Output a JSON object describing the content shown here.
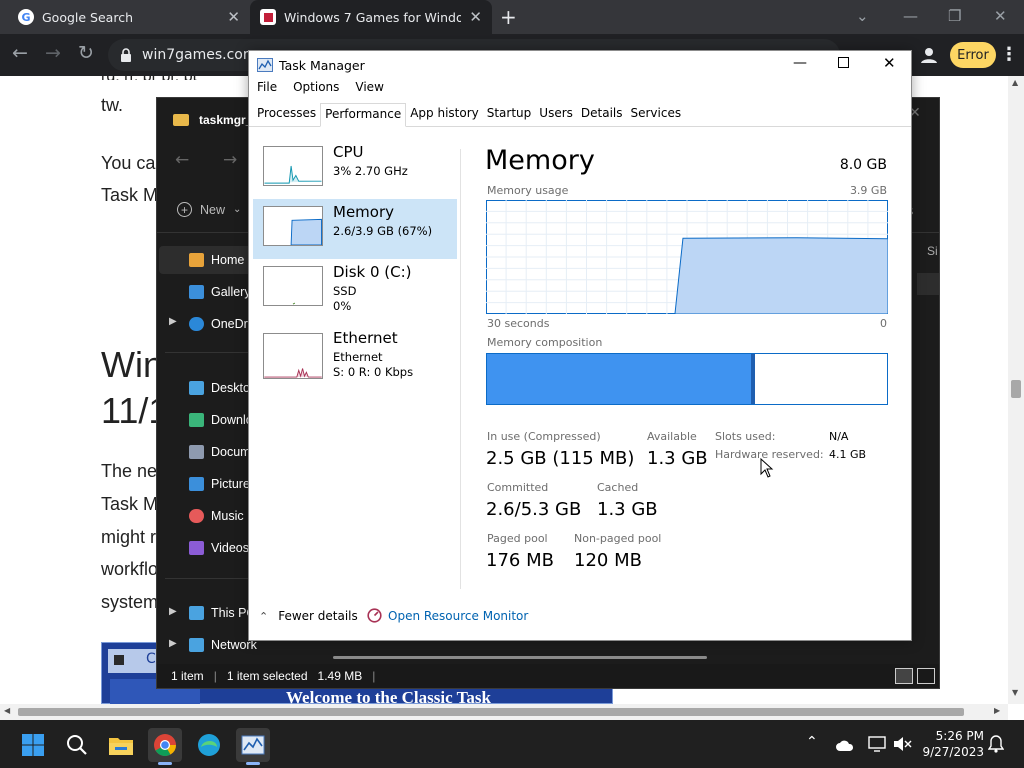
{
  "browser": {
    "tabs": [
      {
        "title": "Google Search",
        "active": false
      },
      {
        "title": "Windows 7 Games for Windows",
        "active": true
      }
    ],
    "new_tab_symbol": "+",
    "url": "win7games.com",
    "error_button": "Error"
  },
  "webpage": {
    "line1": "tw.",
    "para1_a": "You ca",
    "para1_b": "Task M",
    "heading_a": "Win",
    "heading_b": "11/1",
    "para2": [
      "The ne",
      "Task M",
      "might r",
      "workflo",
      "system"
    ],
    "banner_text": "Welcome to the Classic Task",
    "banner_label": "C"
  },
  "explorer": {
    "title": "taskmgr_",
    "new_label": "New",
    "sidebar": [
      {
        "label": "Home",
        "icon": "home-icon",
        "color": "#e8a33a"
      },
      {
        "label": "Gallery",
        "icon": "gallery-icon",
        "color": "#3b8fdb"
      },
      {
        "label": "OneDri",
        "icon": "onedrive-icon",
        "color": "#2b88d8"
      },
      {
        "label": "Deskto",
        "icon": "desktop-icon",
        "color": "#4aa3e0"
      },
      {
        "label": "Downlo",
        "icon": "download-icon",
        "color": "#3ab57a"
      },
      {
        "label": "Docum",
        "icon": "documents-icon",
        "color": "#8e9aaf"
      },
      {
        "label": "Picture",
        "icon": "pictures-icon",
        "color": "#3b8fdb"
      },
      {
        "label": "Music",
        "icon": "music-icon",
        "color": "#e65a5a"
      },
      {
        "label": "Videos",
        "icon": "videos-icon",
        "color": "#8b5cd6"
      },
      {
        "label": "This PC",
        "icon": "pc-icon",
        "color": "#4aa3e0"
      },
      {
        "label": "Network",
        "icon": "network-icon",
        "color": "#4aa3e0"
      }
    ],
    "col_header": "Si",
    "status": {
      "items": "1 item",
      "selected": "1 item selected",
      "size": "1.49 MB"
    }
  },
  "taskmanager": {
    "title": "Task Manager",
    "menu": [
      "File",
      "Options",
      "View"
    ],
    "tabs": [
      "Processes",
      "Performance",
      "App history",
      "Startup",
      "Users",
      "Details",
      "Services"
    ],
    "selected_tab": "Performance",
    "resources": [
      {
        "name": "CPU",
        "line1": "3%  2.70 GHz",
        "line2": "",
        "selected": false
      },
      {
        "name": "Memory",
        "line1": "2.6/3.9 GB (67%)",
        "line2": "",
        "selected": true
      },
      {
        "name": "Disk 0 (C:)",
        "line1": "SSD",
        "line2": "0%",
        "selected": false
      },
      {
        "name": "Ethernet",
        "line1": "Ethernet",
        "line2": "S: 0  R: 0 Kbps",
        "selected": false
      }
    ],
    "memory": {
      "title": "Memory",
      "total": "8.0 GB",
      "usage_label": "Memory usage",
      "usage_max": "3.9 GB",
      "graph_left": "30 seconds",
      "graph_right": "0",
      "usage_level": 0.66,
      "composition_label": "Memory composition",
      "composition_in_use": 0.66,
      "composition_modified": 0.01,
      "stats": {
        "in_use_label": "In use (Compressed)",
        "in_use": "2.5 GB (115 MB)",
        "available_label": "Available",
        "available": "1.3 GB",
        "committed_label": "Committed",
        "committed": "2.6/5.3 GB",
        "cached_label": "Cached",
        "cached": "1.3 GB",
        "paged_label": "Paged pool",
        "paged": "176 MB",
        "nonpaged_label": "Non-paged pool",
        "nonpaged": "120 MB",
        "slots_label": "Slots used:",
        "slots": "N/A",
        "hw_label": "Hardware reserved:",
        "hw": "4.1 GB"
      }
    },
    "fewer_details": "Fewer details",
    "resource_monitor": "Open Resource Monitor"
  },
  "taskbar": {
    "time": "5:26 PM",
    "date": "9/27/2023"
  },
  "colors": {
    "memory_fill": "#bcd6f5",
    "memory_line": "#0b6bc7",
    "composition_used": "#3f93f0",
    "selection": "#cce4f7",
    "link": "#0063b1",
    "error_button": "#fdd663"
  }
}
